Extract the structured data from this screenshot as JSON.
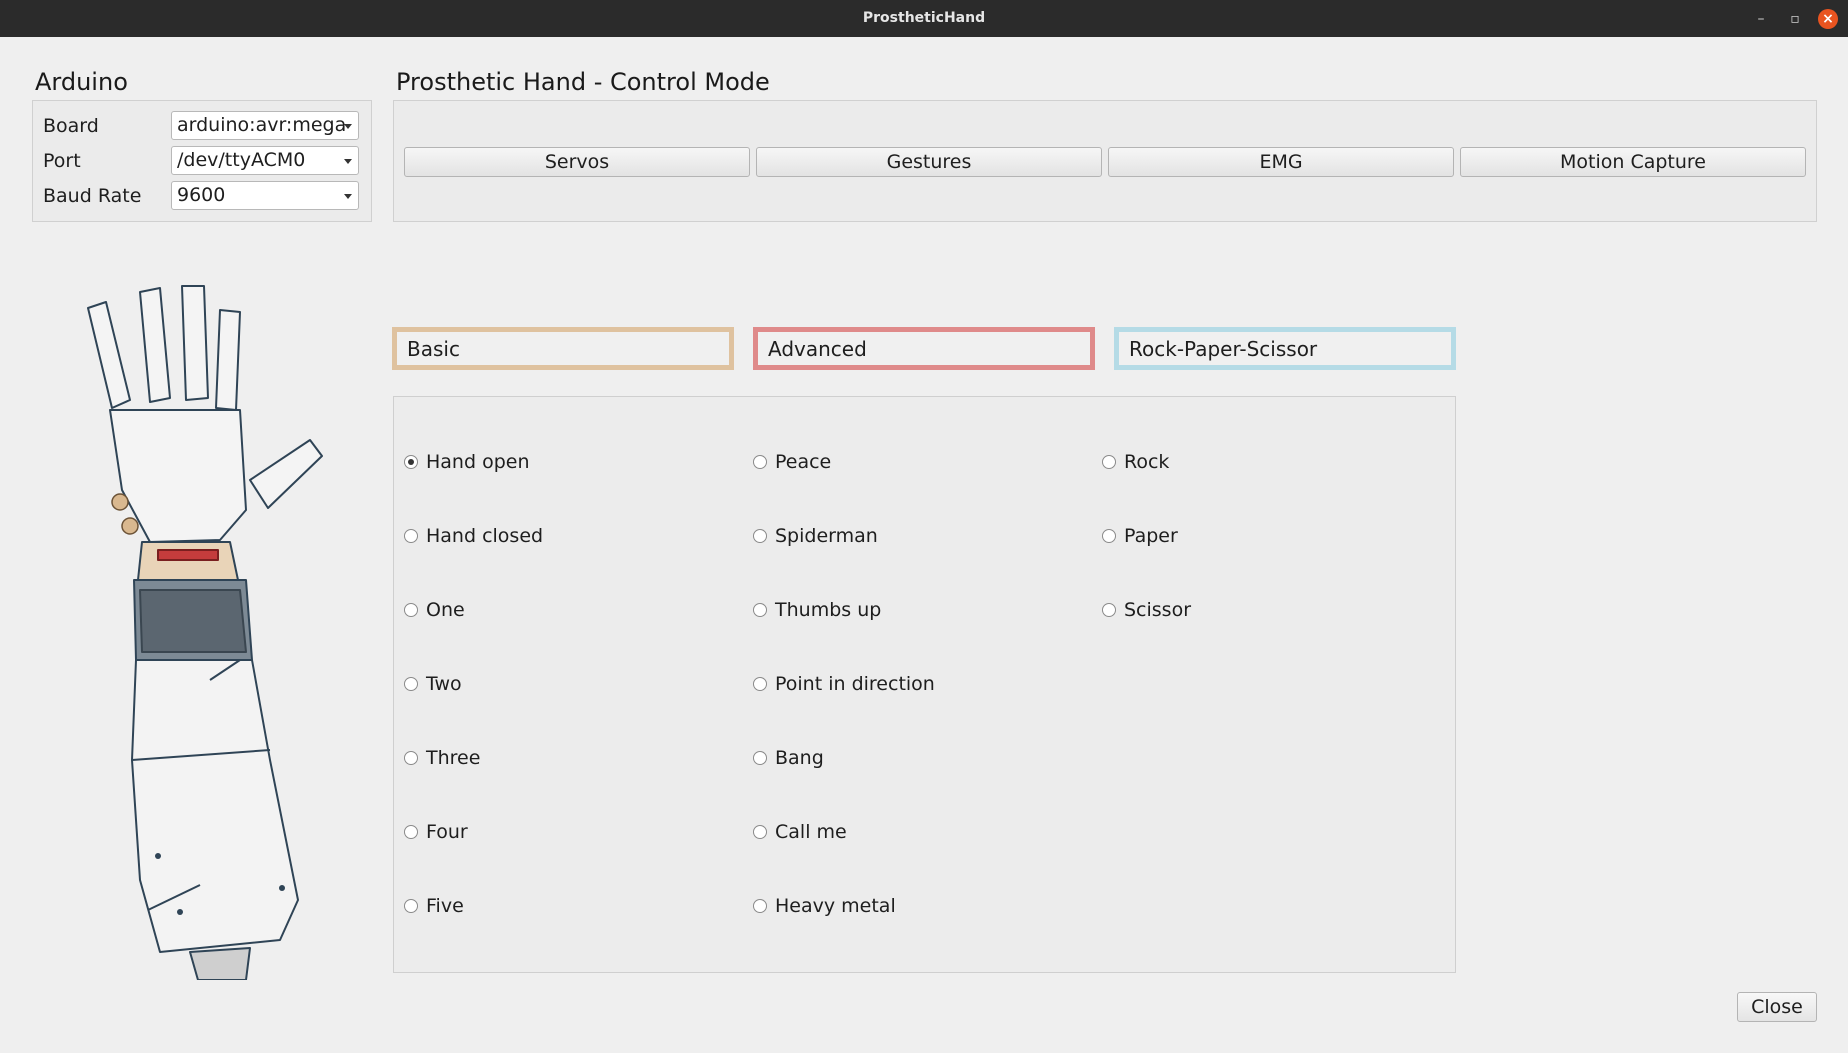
{
  "window": {
    "title": "ProstheticHand"
  },
  "arduino": {
    "title": "Arduino",
    "fields": [
      {
        "label": "Board",
        "value": "arduino:avr:mega"
      },
      {
        "label": "Port",
        "value": "/dev/ttyACM0"
      },
      {
        "label": "Baud Rate",
        "value": "9600"
      }
    ]
  },
  "control": {
    "title": "Prosthetic Hand - Control Mode",
    "modes": [
      "Servos",
      "Gestures",
      "EMG",
      "Motion Capture"
    ]
  },
  "categories": {
    "basic": {
      "label": "Basic",
      "color": "#dfc29f"
    },
    "advanced": {
      "label": "Advanced",
      "color": "#df8a8a"
    },
    "rps": {
      "label": "Rock-Paper-Scissor",
      "color": "#b5dbe6"
    }
  },
  "gestures": {
    "basic": [
      "Hand open",
      "Hand closed",
      "One",
      "Two",
      "Three",
      "Four",
      "Five"
    ],
    "advanced": [
      "Peace",
      "Spiderman",
      "Thumbs up",
      "Point in direction",
      "Bang",
      "Call me",
      "Heavy metal"
    ],
    "rps": [
      "Rock",
      "Paper",
      "Scissor"
    ],
    "selected": "Hand open"
  },
  "footer": {
    "close_label": "Close"
  },
  "image": {
    "icon": "prosthetic-arm-image"
  }
}
